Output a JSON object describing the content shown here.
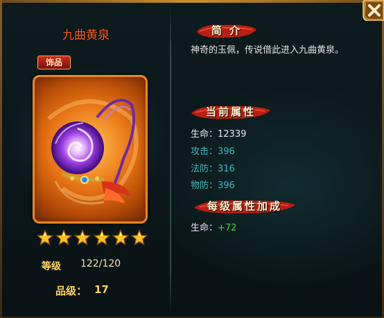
{
  "item": {
    "name": "九曲黄泉",
    "category": "饰品",
    "stars": 6
  },
  "level": {
    "label": "等级",
    "value": "122/120"
  },
  "grade": {
    "label": "品级：",
    "value": "17"
  },
  "sections": {
    "intro": {
      "title": "简 介",
      "text": "神奇的玉佩，传说借此进入九曲黄泉。"
    },
    "current": {
      "title": "当前属性",
      "stats": [
        {
          "label": "生命：",
          "value": "12339"
        },
        {
          "label": "攻击：",
          "value": "396"
        },
        {
          "label": "法防：",
          "value": "316"
        },
        {
          "label": "物防：",
          "value": "396"
        }
      ]
    },
    "growth": {
      "title": "每级属性加成",
      "stats": [
        {
          "label": "生命：",
          "value": "+72"
        }
      ]
    }
  },
  "close_label": "X",
  "colors": {
    "accent_orange": "#e88a1e",
    "name_red": "#ff5a1e",
    "stat_teal": "#3fb7bf",
    "bonus_green": "#33dd33",
    "gold_text": "#ffd35b"
  },
  "icons": [
    "close-icon",
    "star-icon",
    "jade-pendant-icon"
  ]
}
